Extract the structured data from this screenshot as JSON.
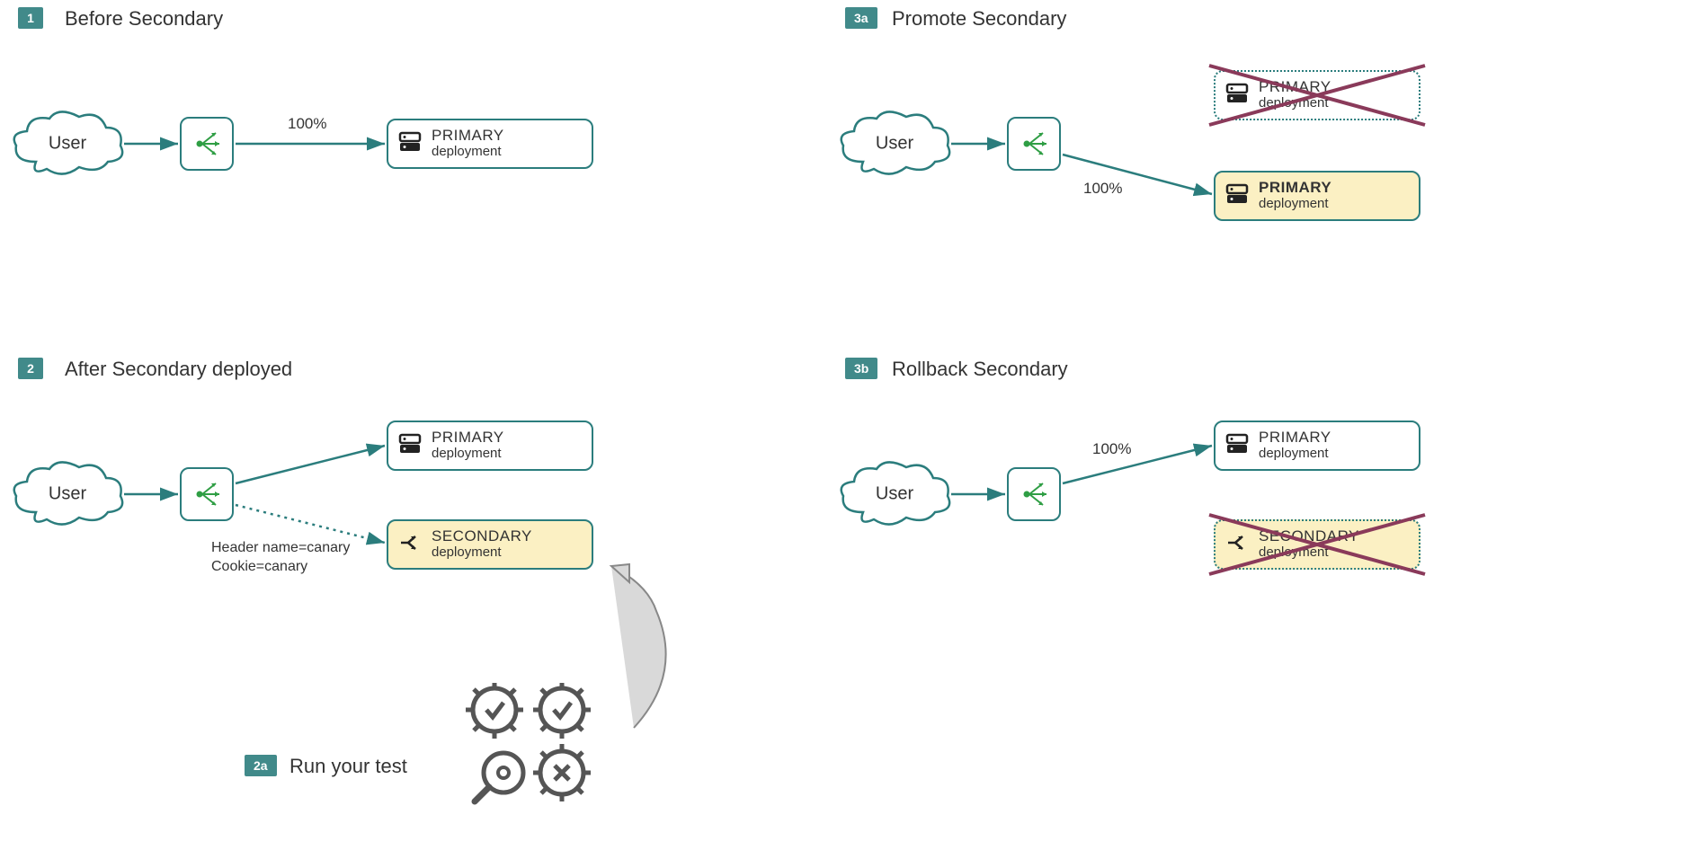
{
  "steps": {
    "s1": {
      "badge": "1",
      "title": "Before Secondary"
    },
    "s2": {
      "badge": "2",
      "title": "After Secondary deployed"
    },
    "s2a": {
      "badge": "2a",
      "title": "Run your test"
    },
    "s3a": {
      "badge": "3a",
      "title": "Promote Secondary"
    },
    "s3b": {
      "badge": "3b",
      "title": "Rollback Secondary"
    }
  },
  "labels": {
    "user": "User",
    "primary": "PRIMARY",
    "secondary": "SECONDARY",
    "deployment": "deployment",
    "pct100": "100%",
    "header_rule": "Header name=canary",
    "cookie_rule": "Cookie=canary"
  },
  "colors": {
    "teal": "#2b7d7d",
    "badge": "#418a8a",
    "highlight": "#fbf0c3",
    "cross": "#8a3a5a",
    "lb_green": "#2f9e44"
  }
}
